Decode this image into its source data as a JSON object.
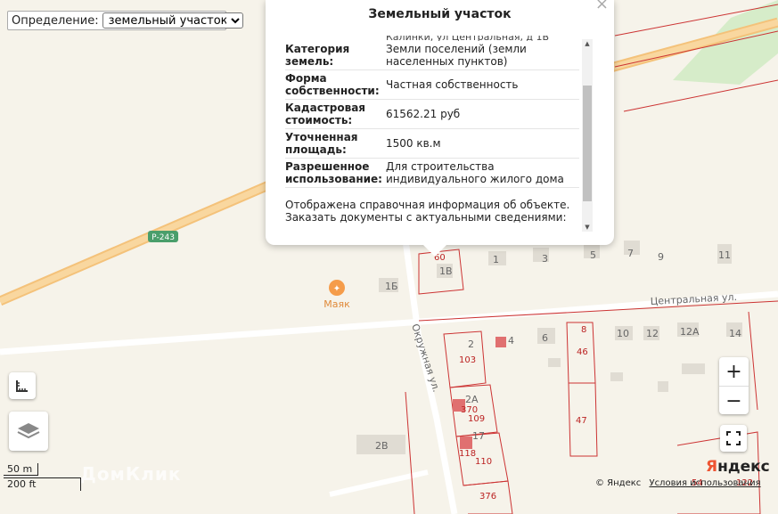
{
  "definition": {
    "label": "Определение:",
    "selected": "земельный участок"
  },
  "popup": {
    "title": "Земельный участок",
    "address_cut": "Калинки, ул Центральная, д 1В",
    "rows": [
      {
        "key": "Категория земель:",
        "value": "Земли поселений (земли населенных пунктов)"
      },
      {
        "key": "Форма собственности:",
        "value": "Частная собственность"
      },
      {
        "key": "Кадастровая стоимость:",
        "value": "61562.21 руб"
      },
      {
        "key": "Уточненная площадь:",
        "value": "1500 кв.м"
      },
      {
        "key": "Разрешенное использование:",
        "value": "Для строительства индивидуального жилого дома"
      }
    ],
    "note": "Отображена справочная информация об объекте. Заказать документы с актуальными сведениями:"
  },
  "map": {
    "road_label": "Р-243",
    "poi_label": "Маяк",
    "street_central": "Центральная ул.",
    "street_okruzhnaya": "Окружная ул.",
    "house_numbers": [
      "60",
      "1В",
      "1",
      "3",
      "5",
      "7",
      "9",
      "11",
      "1Б",
      "4",
      "6",
      "8",
      "10",
      "12",
      "12А",
      "14",
      "2",
      "103",
      "2А",
      "370",
      "109",
      "17",
      "118",
      "110",
      "376",
      "46",
      "47",
      "2В",
      "54",
      "122"
    ]
  },
  "controls": {
    "zoom_in": "+",
    "zoom_out": "−"
  },
  "scale": {
    "metric": "50 m",
    "imperial": "200 ft"
  },
  "attribution": {
    "copyright": "© Яндекс",
    "terms": "Условия использования"
  },
  "brand": {
    "first_letter": "Я",
    "rest": "ндекс"
  },
  "watermark": "ДомКлик"
}
